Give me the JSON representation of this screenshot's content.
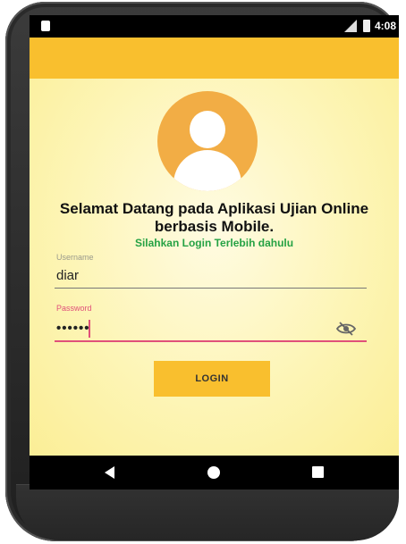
{
  "status_bar": {
    "time": "4:08",
    "icons": [
      "sim-card-icon",
      "signal-icon",
      "battery-icon"
    ]
  },
  "login": {
    "title": "Selamat Datang pada Aplikasi Ujian Online berbasis Mobile.",
    "subtitle": "Silahkan Login Terlebih dahulu",
    "username": {
      "label": "Username",
      "value": "diar"
    },
    "password": {
      "label": "Password",
      "value": "••••••",
      "toggle_icon": "eye-off-icon"
    },
    "button_label": "LOGIN"
  },
  "nav_bar": {
    "icons": [
      "back-icon",
      "home-icon",
      "recent-apps-icon"
    ]
  },
  "colors": {
    "accent": "#f9bf2e",
    "avatar": "#f2ad45",
    "subtitle": "#25a244",
    "focused_field": "#e0507a",
    "background": "#fdf5b6"
  }
}
